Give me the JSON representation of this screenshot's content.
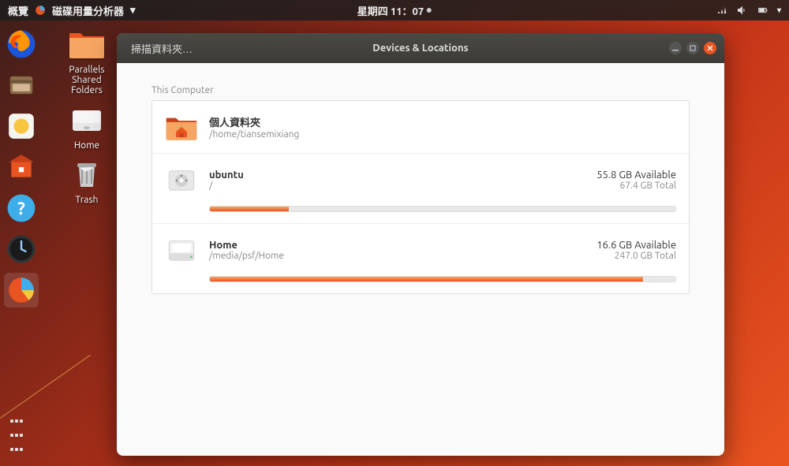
{
  "topbar": {
    "overview": "概覽",
    "app_name": "磁碟用量分析器",
    "datetime": "星期四 11：07",
    "icons": {
      "network": "network-icon",
      "volume": "volume-icon",
      "battery": "battery-icon",
      "power": "power-icon"
    }
  },
  "desktop": {
    "parallels": "Parallels Shared Folders",
    "home": "Home",
    "trash": "Trash"
  },
  "window": {
    "scan_button": "掃描資料夾…",
    "title": "Devices & Locations",
    "section_label": "This Computer",
    "rows": [
      {
        "title": "個人資料夾",
        "path": "/home/tiansemixiang",
        "available": "",
        "total": "",
        "used_pct": 0
      },
      {
        "title": "ubuntu",
        "path": "/",
        "available": "55.8 GB Available",
        "total": "67.4 GB Total",
        "used_pct": 17
      },
      {
        "title": "Home",
        "path": "/media/psf/Home",
        "available": "16.6 GB Available",
        "total": "247.0 GB Total",
        "used_pct": 93
      }
    ]
  },
  "colors": {
    "accent": "#e95420"
  }
}
